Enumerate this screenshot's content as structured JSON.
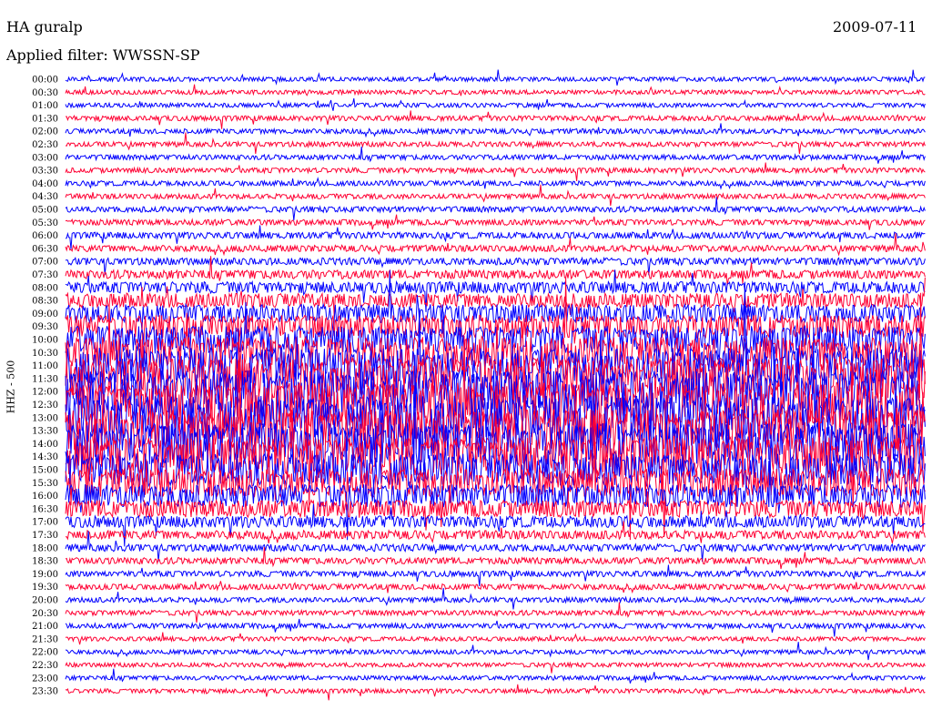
{
  "header": {
    "station": "HA guralp",
    "date": "2009-07-11",
    "filter_label": "Applied filter: WWSSN-SP"
  },
  "channel_label": "HHZ - 500",
  "chart_data": {
    "type": "line",
    "title": "HA guralp",
    "ylabel": "HHZ - 500",
    "rows": [
      "00:00",
      "00:30",
      "01:00",
      "01:30",
      "02:00",
      "02:30",
      "03:00",
      "03:30",
      "04:00",
      "04:30",
      "05:00",
      "05:30",
      "06:00",
      "06:30",
      "07:00",
      "07:30",
      "08:00",
      "08:30",
      "09:00",
      "09:30",
      "10:00",
      "10:30",
      "11:00",
      "11:30",
      "12:00",
      "12:30",
      "13:00",
      "13:30",
      "14:00",
      "14:30",
      "15:00",
      "15:30",
      "16:00",
      "16:30",
      "17:00",
      "17:30",
      "18:00",
      "18:30",
      "19:00",
      "19:30",
      "20:00",
      "20:30",
      "21:00",
      "21:30",
      "22:00",
      "22:30",
      "23:00",
      "23:30"
    ],
    "row_minutes": 30,
    "series_colors": [
      "#0000ff",
      "#ff0033"
    ],
    "relative_amplitude": [
      0.3,
      0.3,
      0.3,
      0.35,
      0.35,
      0.35,
      0.35,
      0.35,
      0.35,
      0.35,
      0.4,
      0.4,
      0.45,
      0.45,
      0.5,
      0.6,
      0.8,
      1.0,
      1.3,
      1.6,
      1.9,
      2.2,
      2.5,
      2.8,
      3.0,
      3.1,
      3.1,
      3.0,
      2.9,
      2.7,
      2.3,
      2.0,
      1.6,
      1.2,
      0.8,
      0.6,
      0.5,
      0.45,
      0.4,
      0.4,
      0.35,
      0.35,
      0.35,
      0.3,
      0.3,
      0.3,
      0.3,
      0.3
    ]
  }
}
